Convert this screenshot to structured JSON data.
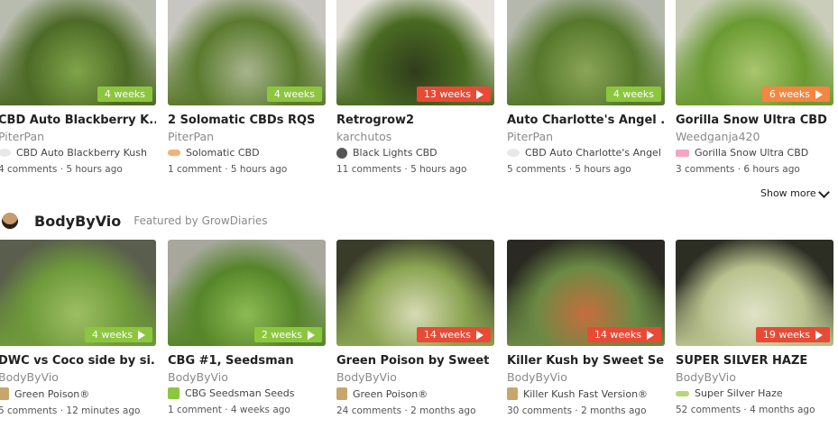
{
  "row1": [
    {
      "title": "CBD Auto Blackberry K...",
      "author": "PiterPan",
      "strain": "CBD Auto Blackberry Kush",
      "strain_icon": "leaf-icon",
      "meta": "4 comments · 5 hours ago",
      "badge": "4 weeks",
      "badge_color": "#8cc63f",
      "badge_play": false,
      "thumb_colors": [
        "#b8bcae",
        "#4d6a26",
        "#7fa44a"
      ]
    },
    {
      "title": "2 Solomatic CBDs RQS",
      "author": "PiterPan",
      "strain": "Solomatic CBD",
      "strain_icon": "seed-icon",
      "meta": "1 comment · 5 hours ago",
      "badge": "4 weeks",
      "badge_color": "#8cc63f",
      "badge_play": false,
      "thumb_colors": [
        "#c8c6c0",
        "#5b7a2e",
        "#a7b58c"
      ]
    },
    {
      "title": "Retrogrow2",
      "author": "karchutos",
      "strain": "Black Lights CBD",
      "strain_icon": "bulb-icon",
      "meta": "11 comments · 5 hours ago",
      "badge": "13 weeks",
      "badge_color": "#e94a35",
      "badge_play": true,
      "thumb_colors": [
        "#e4e0da",
        "#4a6b23",
        "#2f3c1b"
      ]
    },
    {
      "title": "Auto Charlotte's Angel ...",
      "author": "PiterPan",
      "strain": "CBD Auto Charlotte's Angel",
      "strain_icon": "leaf-icon",
      "meta": "5 comments · 5 hours ago",
      "badge": "4 weeks",
      "badge_color": "#8cc63f",
      "badge_play": false,
      "thumb_colors": [
        "#b5b8ac",
        "#56782c",
        "#8aa556"
      ]
    },
    {
      "title": "Gorilla Snow Ultra CBD",
      "author": "Weedganja420",
      "strain": "Gorilla Snow Ultra CBD",
      "strain_icon": "logo-icon",
      "meta": "3 comments · 6 hours ago",
      "badge": "6 weeks",
      "badge_color": "#f5853f",
      "badge_play": true,
      "thumb_colors": [
        "#c9cdb9",
        "#6a9a31",
        "#a8c66e"
      ]
    }
  ],
  "show_more": "Show more",
  "section": {
    "name": "BodyByVio",
    "subtitle": "Featured by GrowDiaries"
  },
  "row2": [
    {
      "title": "DWC vs Coco side by si...",
      "author": "BodyByVio",
      "strain": "Green Poison®",
      "strain_icon": "bottle-icon",
      "meta": "5 comments · 12 minutes ago",
      "badge": "4 weeks",
      "badge_color": "#8cc63f",
      "badge_play": true,
      "thumb_colors": [
        "#5a5e4c",
        "#6f9a3a",
        "#9dbf63"
      ]
    },
    {
      "title": "CBG #1, Seedsman",
      "author": "BodyByVio",
      "strain": "CBG Seedsman Seeds",
      "strain_icon": "cbg-icon",
      "meta": "1 comment · 4 weeks ago",
      "badge": "2 weeks",
      "badge_color": "#8cc63f",
      "badge_play": true,
      "thumb_colors": [
        "#a7a79b",
        "#56852a",
        "#8cba52"
      ]
    },
    {
      "title": "Green Poison by Sweet ...",
      "author": "BodyByVio",
      "strain": "Green Poison®",
      "strain_icon": "bottle-icon",
      "meta": "24 comments · 2 months ago",
      "badge": "14 weeks",
      "badge_color": "#e94a35",
      "badge_play": true,
      "thumb_colors": [
        "#3a3c2a",
        "#8aa451",
        "#d8dbb6"
      ]
    },
    {
      "title": "Killer Kush by Sweet Se...",
      "author": "BodyByVio",
      "strain": "Killer Kush Fast Version®",
      "strain_icon": "bottle-icon",
      "meta": "30 comments · 2 months ago",
      "badge": "14 weeks",
      "badge_color": "#e94a35",
      "badge_play": true,
      "thumb_colors": [
        "#2a2a22",
        "#6b8a44",
        "#c66d3e"
      ]
    },
    {
      "title": "SUPER SILVER HAZE",
      "author": "BodyByVio",
      "strain": "Super Silver Haze",
      "strain_icon": "silver-icon",
      "meta": "52 comments · 4 months ago",
      "badge": "19 weeks",
      "badge_color": "#e94a35",
      "badge_play": true,
      "thumb_colors": [
        "#2c2e24",
        "#b9c28e",
        "#e0e3c7"
      ]
    }
  ]
}
